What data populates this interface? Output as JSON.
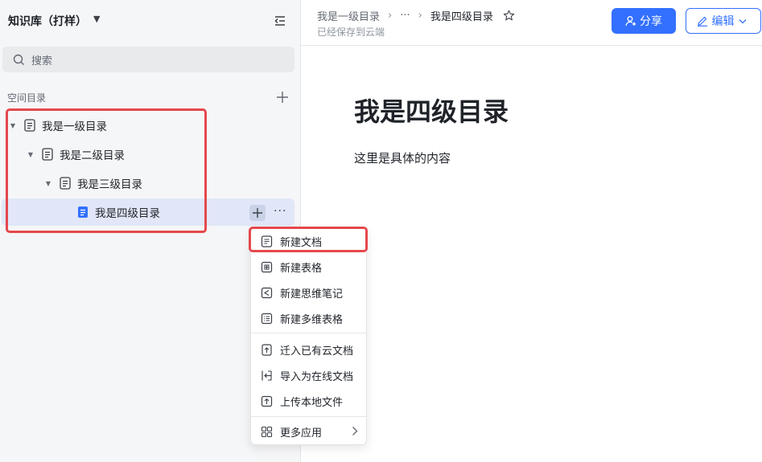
{
  "sidebar": {
    "kb_title": "知识库（打样）",
    "search_placeholder": "搜索",
    "section_label": "空间目录",
    "tree": [
      {
        "label": "我是一级目录"
      },
      {
        "label": "我是二级目录"
      },
      {
        "label": "我是三级目录"
      },
      {
        "label": "我是四级目录"
      }
    ]
  },
  "menu": {
    "items": [
      {
        "label": "新建文档",
        "icon": "doc-icon"
      },
      {
        "label": "新建表格",
        "icon": "sheet-icon"
      },
      {
        "label": "新建思维笔记",
        "icon": "mindnote-icon"
      },
      {
        "label": "新建多维表格",
        "icon": "bitable-icon"
      },
      {
        "label": "迁入已有云文档",
        "icon": "move-in-icon"
      },
      {
        "label": "导入为在线文档",
        "icon": "import-icon"
      },
      {
        "label": "上传本地文件",
        "icon": "upload-icon"
      },
      {
        "label": "更多应用",
        "icon": "apps-icon"
      }
    ]
  },
  "header": {
    "breadcrumb": {
      "first": "我是一级目录",
      "ellipsis": "···",
      "current": "我是四级目录"
    },
    "saved_status": "已经保存到云端",
    "share_label": "分享",
    "edit_label": "编辑"
  },
  "document": {
    "title": "我是四级目录",
    "body": "这里是具体的内容"
  },
  "colors": {
    "accent": "#3370ff",
    "highlight": "#e5484d",
    "active_row": "#e1e7f8"
  }
}
